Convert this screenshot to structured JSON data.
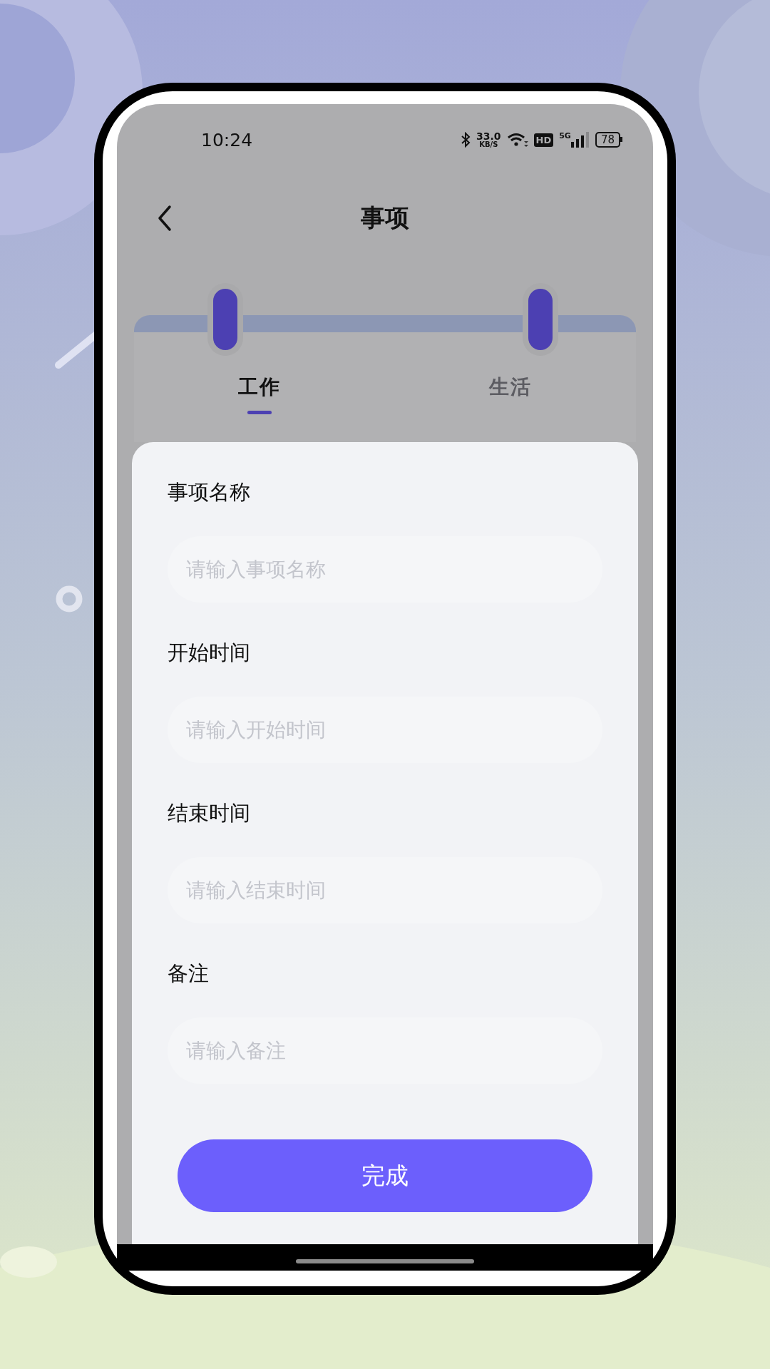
{
  "status_bar": {
    "time": "10:24",
    "net_speed": "33.0",
    "net_unit": "KB/S",
    "hd": "HD",
    "network": "5G",
    "battery": "78"
  },
  "header": {
    "title": "事项"
  },
  "tabs": [
    {
      "label": "工作",
      "selected": true
    },
    {
      "label": "生活",
      "selected": false
    }
  ],
  "form": {
    "fields": [
      {
        "label": "事项名称",
        "placeholder": "请输入事项名称"
      },
      {
        "label": "开始时间",
        "placeholder": "请输入开始时间"
      },
      {
        "label": "结束时间",
        "placeholder": "请输入结束时间"
      },
      {
        "label": "备注",
        "placeholder": "请输入备注"
      }
    ],
    "submit": "完成"
  }
}
